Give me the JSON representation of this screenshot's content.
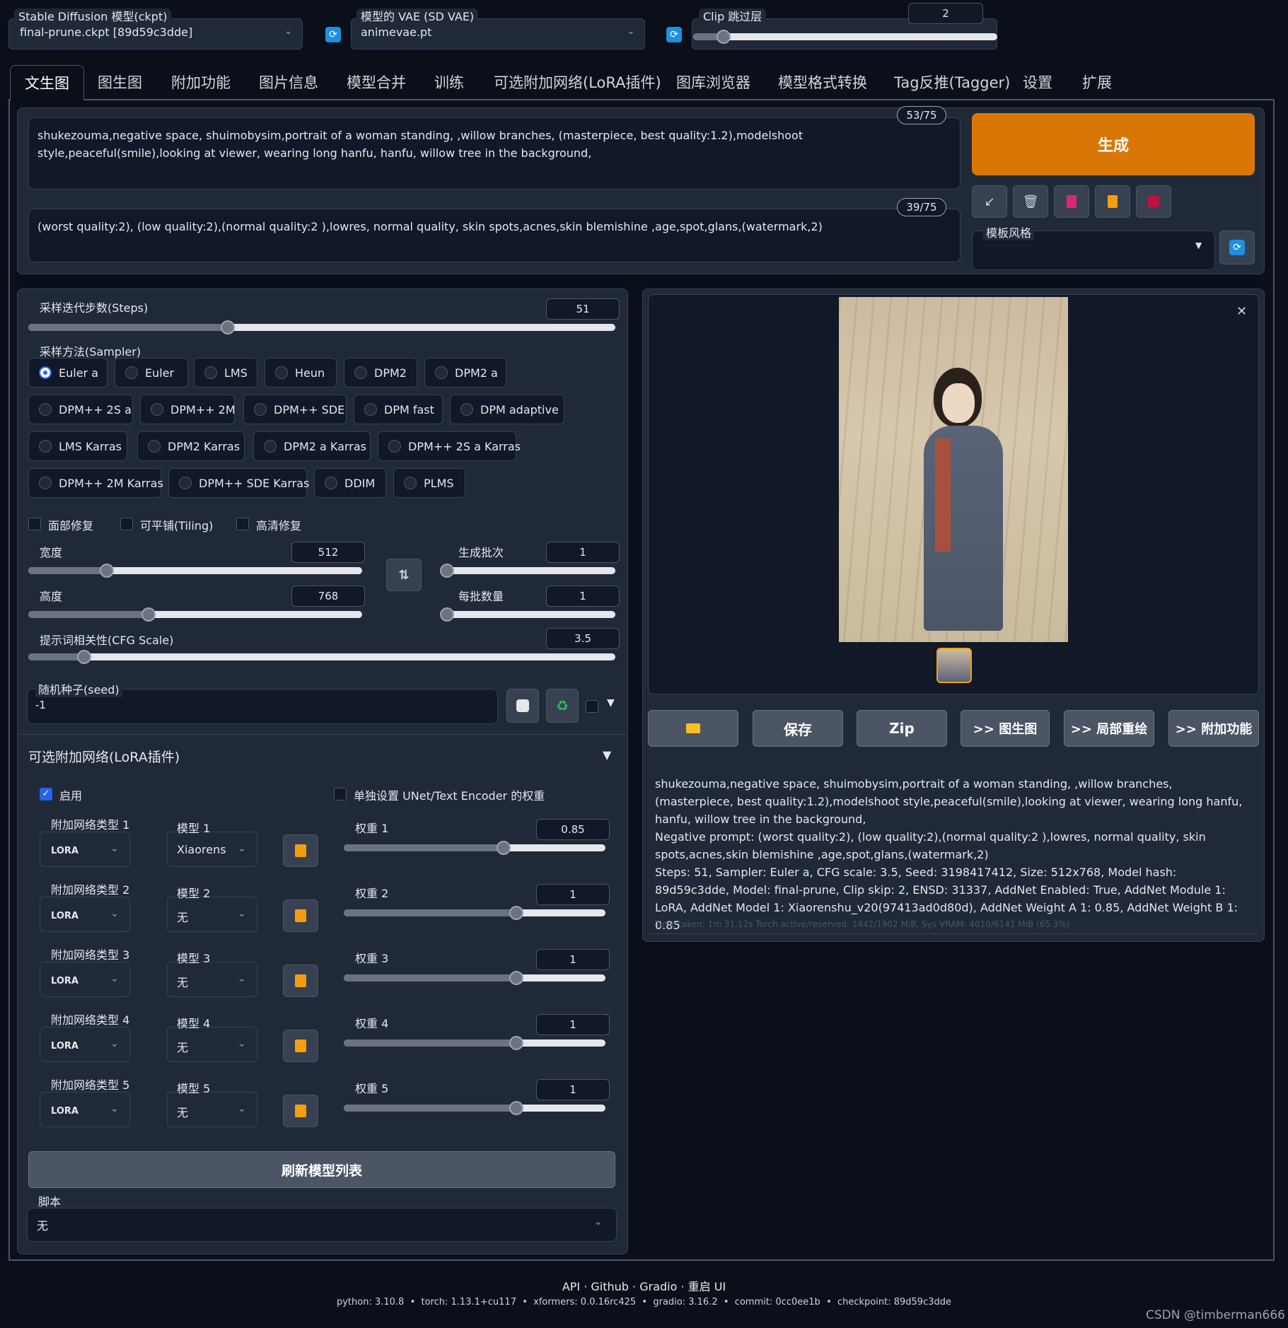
{
  "top": {
    "ckpt_label": "Stable Diffusion 模型(ckpt)",
    "ckpt_value": "final-prune.ckpt [89d59c3dde]",
    "vae_label": "模型的 VAE (SD VAE)",
    "vae_value": "animevae.pt",
    "clip_label": "Clip 跳过层",
    "clip_value": "2",
    "clip_fraction": 0.1
  },
  "tabs": [
    "文生图",
    "图生图",
    "附加功能",
    "图片信息",
    "模型合并",
    "训练",
    "可选附加网络(LoRA插件)",
    "图库浏览器",
    "模型格式转换",
    "Tag反推(Tagger)",
    "设置",
    "扩展"
  ],
  "prompt": {
    "positive": "shukezouma,negative space, shuimobysim,portrait of a woman standing, ,willow branches, (masterpiece, best quality:1.2),modelshoot style,peaceful(smile),looking at viewer, wearing long hanfu, hanfu, willow tree in the background,",
    "positive_count": "53/75",
    "negative": "(worst quality:2), (low quality:2),(normal quality:2 ),lowres, normal quality, skin spots,acnes,skin blemishine ,age,spot,glans,(watermark,2)",
    "negative_count": "39/75"
  },
  "generate_label": "生成",
  "style_label": "模板风格",
  "steps": {
    "label": "采样迭代步数(Steps)",
    "value": "51",
    "fraction": 0.34
  },
  "sampler": {
    "label": "采样方法(Sampler)",
    "options": [
      "Euler a",
      "Euler",
      "LMS",
      "Heun",
      "DPM2",
      "DPM2 a",
      "DPM++ 2S a",
      "DPM++ 2M",
      "DPM++ SDE",
      "DPM fast",
      "DPM adaptive",
      "LMS Karras",
      "DPM2 Karras",
      "DPM2 a Karras",
      "DPM++ 2S a Karras",
      "DPM++ 2M Karras",
      "DPM++ SDE Karras",
      "DDIM",
      "PLMS"
    ],
    "selected": "Euler a"
  },
  "checks": {
    "face": "面部修复",
    "tiling": "可平铺(Tiling)",
    "hires": "高清修复"
  },
  "width": {
    "label": "宽度",
    "value": "512",
    "fraction": 0.235
  },
  "height": {
    "label": "高度",
    "value": "768",
    "fraction": 0.36
  },
  "batch_count": {
    "label": "生成批次",
    "value": "1",
    "fraction": 0
  },
  "batch_size": {
    "label": "每批数量",
    "value": "1",
    "fraction": 0
  },
  "cfg": {
    "label": "提示词相关性(CFG Scale)",
    "value": "3.5",
    "fraction": 0.095
  },
  "seed": {
    "label": "随机种子(seed)",
    "value": "-1"
  },
  "lora": {
    "title": "可选附加网络(LoRA插件)",
    "enable_label": "启用",
    "separate_label": "单独设置 UNet/Text Encoder 的权重",
    "rows": [
      {
        "type_label": "附加网络类型 1",
        "type_value": "LoRA",
        "model_label": "模型 1",
        "model_value": "Xiaorens",
        "weight_label": "权重 1",
        "weight_value": "0.85",
        "fraction": 0.61
      },
      {
        "type_label": "附加网络类型 2",
        "type_value": "LoRA",
        "model_label": "模型 2",
        "model_value": "无",
        "weight_label": "权重 2",
        "weight_value": "1",
        "fraction": 0.66
      },
      {
        "type_label": "附加网络类型 3",
        "type_value": "LoRA",
        "model_label": "模型 3",
        "model_value": "无",
        "weight_label": "权重 3",
        "weight_value": "1",
        "fraction": 0.66
      },
      {
        "type_label": "附加网络类型 4",
        "type_value": "LoRA",
        "model_label": "模型 4",
        "model_value": "无",
        "weight_label": "权重 4",
        "weight_value": "1",
        "fraction": 0.66
      },
      {
        "type_label": "附加网络类型 5",
        "type_value": "LoRA",
        "model_label": "模型 5",
        "model_value": "无",
        "weight_label": "权重 5",
        "weight_value": "1",
        "fraction": 0.66
      }
    ],
    "refresh_label": "刷新模型列表"
  },
  "script": {
    "label": "脚本",
    "value": "无"
  },
  "output": {
    "buttons": {
      "save": "保存",
      "zip": "Zip",
      "img2img": ">> 图生图",
      "inpaint": ">> 局部重绘",
      "extras": ">> 附加功能"
    },
    "info_line1": "shukezouma,negative space, shuimobysim,portrait of a woman standing, ,willow branches, (masterpiece, best quality:1.2),modelshoot style,peaceful(smile),looking at viewer, wearing long hanfu, hanfu, willow tree in the background,",
    "info_line2": "Negative prompt: (worst quality:2), (low quality:2),(normal quality:2 ),lowres, normal quality, skin spots,acnes,skin blemishine ,age,spot,glans,(watermark,2)",
    "info_line3": "Steps: 51, Sampler: Euler a, CFG scale: 3.5, Seed: 3198417412, Size: 512x768, Model hash: 89d59c3dde, Model: final-prune, Clip skip: 2, ENSD: 31337, AddNet Enabled: True, AddNet Module 1: LoRA, AddNet Model 1: Xiaorenshu_v20(97413ad0d80d), AddNet Weight A 1: 0.85, AddNet Weight B 1: 0.85",
    "time": "Time taken: 1m 31.12s  Torch active/reserved: 1442/1902 MiB, Sys VRAM: 4010/6141 MiB (65.3%)"
  },
  "footer": {
    "links": "API · Github · Gradio · 重启 UI",
    "versions": "python: 3.10.8  •  torch: 1.13.1+cu117  •  xformers: 0.0.16rc425  •  gradio: 3.16.2  •  commit: 0cc0ee1b  •  checkpoint: 89d59c3dde",
    "watermark": "CSDN @timberman666"
  }
}
